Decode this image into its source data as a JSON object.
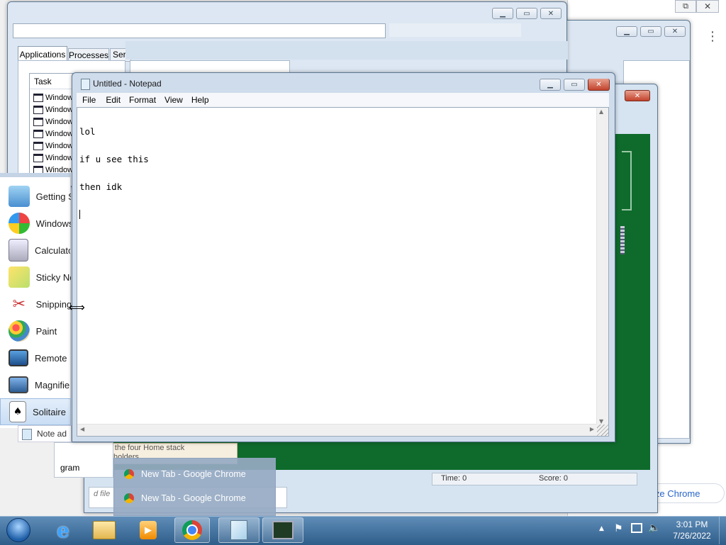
{
  "notepad": {
    "title": "Untitled - Notepad",
    "menu": [
      "File",
      "Edit",
      "Format",
      "View",
      "Help"
    ],
    "lines": [
      "lol",
      "if u see this",
      "then idk"
    ]
  },
  "task_manager": {
    "tabs": [
      "Applications",
      "Processes",
      "Ser"
    ],
    "column_task": "Task",
    "rows": [
      "Window",
      "Window",
      "Window",
      "Window",
      "Window",
      "Window",
      "Window"
    ]
  },
  "start_menu": {
    "items": [
      {
        "label": "Getting St",
        "icon": "getting-started-icon"
      },
      {
        "label": "Windows",
        "icon": "windows-orb-icon"
      },
      {
        "label": "Calculato",
        "icon": "calculator-icon"
      },
      {
        "label": "Sticky No",
        "icon": "sticky-notes-icon"
      },
      {
        "label": "Snipping",
        "icon": "snipping-tool-icon"
      },
      {
        "label": "Paint",
        "icon": "paint-icon"
      },
      {
        "label": "Remote D",
        "icon": "remote-desktop-icon"
      },
      {
        "label": "Magnifier",
        "icon": "magnifier-icon"
      },
      {
        "label": "Solitaire",
        "icon": "solitaire-icon"
      }
    ],
    "notepad_label": "Note ad",
    "programs_fragment": "gram"
  },
  "solitaire": {
    "tooltip_lines": [
      "suit in the four Home stack",
      "place-holders"
    ],
    "time_label": "Time:  0",
    "score_label": "Score: 0"
  },
  "chrome_window": {
    "fragment": "ize Chrome"
  },
  "dialog_fragment": "d file",
  "chrome_jumplist": {
    "items": [
      "New Tab - Google Chrome",
      "New Tab - Google Chrome"
    ]
  },
  "taskbar": {
    "time": "3:01 PM",
    "date": "7/26/2022"
  },
  "colors": {
    "taskbar": "#3a6a9b",
    "solitaire_felt": "#0f6b2c",
    "notepad_frame": "#cfdcec"
  }
}
